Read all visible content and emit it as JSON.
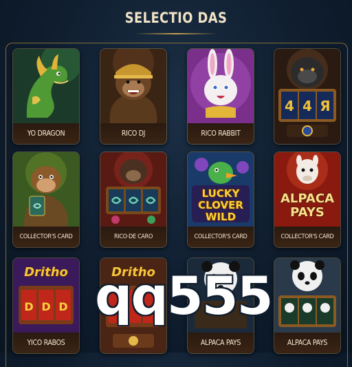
{
  "header": {
    "title": "SELECTIO DAS"
  },
  "cards": [
    {
      "label": "YO DRAGON"
    },
    {
      "label": "RICO DJ"
    },
    {
      "label": "RICO RABBIT"
    },
    {
      "label": ""
    },
    {
      "label": "COLLECTOR'S CARD"
    },
    {
      "label": "RICO·DE CARO"
    },
    {
      "label": "COLLECTOR'S CARD",
      "logo": "LUCKY CLOVER WILD"
    },
    {
      "label": "COLLECTOR'S CARD",
      "logo": "ALPACA PAYS"
    },
    {
      "label": "YICO RABOS",
      "logo": "Dritho"
    },
    {
      "label": "",
      "logo": "Dritho"
    },
    {
      "label": "ALPACA PAYS"
    },
    {
      "label": "ALPACA PAYS"
    }
  ],
  "slot_symbols": {
    "gorilla_reels": "4 4 Я"
  },
  "watermark": "qq555",
  "colors": {
    "accent": "#c8a24b",
    "background": "#0f1d2e",
    "label_bg": "#2a1a10"
  }
}
